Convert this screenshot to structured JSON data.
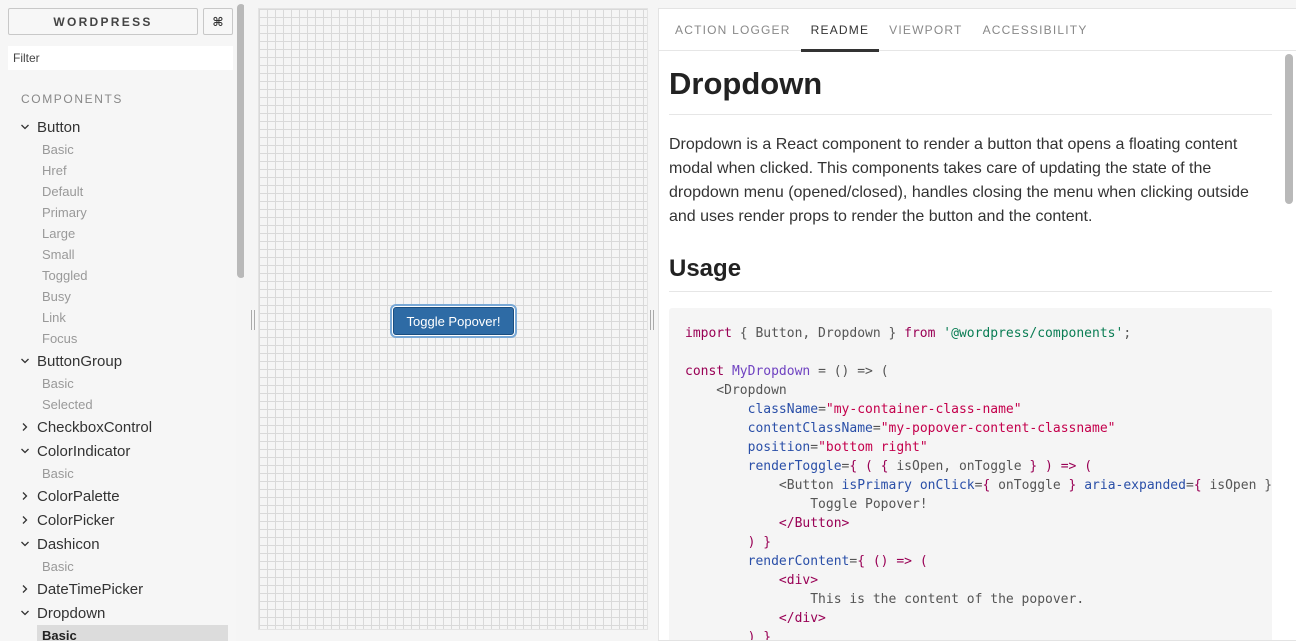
{
  "sidebar": {
    "brand": "WORDPRESS",
    "shortcut": "⌘",
    "filter_placeholder": "Filter",
    "section": "COMPONENTS",
    "tree": [
      {
        "name": "Button",
        "expanded": true,
        "stories": [
          "Basic",
          "Href",
          "Default",
          "Primary",
          "Large",
          "Small",
          "Toggled",
          "Busy",
          "Link",
          "Focus"
        ]
      },
      {
        "name": "ButtonGroup",
        "expanded": true,
        "stories": [
          "Basic",
          "Selected"
        ]
      },
      {
        "name": "CheckboxControl",
        "expanded": false,
        "stories": []
      },
      {
        "name": "ColorIndicator",
        "expanded": true,
        "stories": [
          "Basic"
        ]
      },
      {
        "name": "ColorPalette",
        "expanded": false,
        "stories": []
      },
      {
        "name": "ColorPicker",
        "expanded": false,
        "stories": []
      },
      {
        "name": "Dashicon",
        "expanded": true,
        "stories": [
          "Basic"
        ]
      },
      {
        "name": "DateTimePicker",
        "expanded": false,
        "stories": []
      },
      {
        "name": "Dropdown",
        "expanded": true,
        "stories": [
          "Basic"
        ],
        "selected": "Basic"
      }
    ]
  },
  "preview": {
    "button_label": "Toggle Popover!"
  },
  "addon": {
    "tabs": [
      "ACTION LOGGER",
      "README",
      "VIEWPORT",
      "ACCESSIBILITY"
    ],
    "active_tab": "README",
    "title": "Dropdown",
    "description": "Dropdown is a React component to render a button that opens a floating content modal when clicked. This components takes care of updating the state of the dropdown menu (opened/closed), handles closing the menu when clicking outside and uses render props to render the button and the content.",
    "usage_heading": "Usage",
    "code_lines": [
      [
        [
          "kw2",
          "import"
        ],
        [
          "p",
          " { Button, Dropdown } "
        ],
        [
          "kw2",
          "from"
        ],
        [
          "p",
          " "
        ],
        [
          "str",
          "'@wordpress/components'"
        ],
        [
          "p",
          ";"
        ]
      ],
      [],
      [
        [
          "kw2",
          "const"
        ],
        [
          "p",
          " "
        ],
        [
          "fn",
          "MyDropdown"
        ],
        [
          "p",
          " = () => ("
        ]
      ],
      [
        [
          "p",
          "    <Dropdown"
        ]
      ],
      [
        [
          "p",
          "        "
        ],
        [
          "attr",
          "className"
        ],
        [
          "p",
          "="
        ],
        [
          "str2",
          "\"my-container-class-name\""
        ]
      ],
      [
        [
          "p",
          "        "
        ],
        [
          "attr",
          "contentClassName"
        ],
        [
          "p",
          "="
        ],
        [
          "str2",
          "\"my-popover-content-classname\""
        ]
      ],
      [
        [
          "p",
          "        "
        ],
        [
          "attr",
          "position"
        ],
        [
          "p",
          "="
        ],
        [
          "str2",
          "\"bottom right\""
        ]
      ],
      [
        [
          "p",
          "        "
        ],
        [
          "attr",
          "renderToggle"
        ],
        [
          "p",
          "="
        ],
        [
          "tag",
          "{ ( { "
        ],
        [
          "p",
          "isOpen, onToggle"
        ],
        [
          "tag",
          " } ) => ("
        ]
      ],
      [
        [
          "p",
          "            <Button "
        ],
        [
          "attr",
          "isPrimary"
        ],
        [
          "p",
          " "
        ],
        [
          "attr",
          "onClick"
        ],
        [
          "p",
          "="
        ],
        [
          "tag",
          "{ "
        ],
        [
          "p",
          "onToggle"
        ],
        [
          "tag",
          " }"
        ],
        [
          "p",
          " "
        ],
        [
          "attr",
          "aria-expanded"
        ],
        [
          "p",
          "="
        ],
        [
          "tag",
          "{ "
        ],
        [
          "p",
          "isOpen }"
        ]
      ],
      [
        [
          "p",
          "                Toggle Popover!"
        ]
      ],
      [
        [
          "p",
          "            "
        ],
        [
          "tag",
          "</Button>"
        ]
      ],
      [
        [
          "p",
          "        "
        ],
        [
          "tag",
          ") }"
        ]
      ],
      [
        [
          "p",
          "        "
        ],
        [
          "attr",
          "renderContent"
        ],
        [
          "p",
          "="
        ],
        [
          "tag",
          "{ () => ("
        ]
      ],
      [
        [
          "p",
          "            "
        ],
        [
          "tag",
          "<div>"
        ]
      ],
      [
        [
          "p",
          "                This is the content of the popover."
        ]
      ],
      [
        [
          "p",
          "            "
        ],
        [
          "tag",
          "</div>"
        ]
      ],
      [
        [
          "p",
          "        "
        ],
        [
          "tag",
          ") }"
        ]
      ]
    ]
  }
}
